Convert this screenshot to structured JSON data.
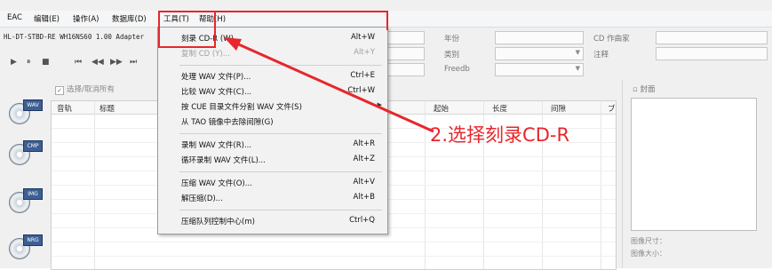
{
  "menubar": {
    "items": [
      "EAC",
      "编辑(E)",
      "操作(A)",
      "数据库(D)",
      "工具(T)",
      "帮助(H)"
    ]
  },
  "drive": {
    "label": "HL-DT-STBD-RE  WH16NS60 1.00  Adapter"
  },
  "transport": {
    "buttons": [
      "▶",
      "⏸",
      "■",
      "⏮",
      "◀◀",
      "▶▶",
      "⏭"
    ]
  },
  "fields": {
    "year_label": "年份",
    "genre_label": "类别",
    "freedb_label": "Freedb",
    "cd_artist_label": "CD 作曲家",
    "notes_label": "注释"
  },
  "select_all": {
    "label": "选择/取消所有"
  },
  "side_icons": [
    "WAV",
    "CMP",
    "IMG",
    "NRG"
  ],
  "track_columns": [
    "音轨",
    "标题",
    "起始",
    "长度",
    "间隙",
    "ブ"
  ],
  "cover": {
    "label": "封面",
    "image_size": "图像尺寸：",
    "image_bytes": "图像大小："
  },
  "tools_menu": {
    "items": [
      {
        "label": "刻录 CD-R (W)...",
        "shortcut": "Alt+W",
        "disabled": false
      },
      {
        "label": "复制 CD (Y)...",
        "shortcut": "Alt+Y",
        "disabled": true
      },
      {
        "label": "处理 WAV 文件(P)...",
        "shortcut": "Ctrl+E",
        "disabled": false
      },
      {
        "label": "比较 WAV 文件(C)...",
        "shortcut": "Ctrl+W",
        "disabled": false
      },
      {
        "label": "按 CUE 目录文件分割 WAV 文件(S)",
        "shortcut": "",
        "disabled": false
      },
      {
        "label": "从 TAO 镜像中去除间隙(G)",
        "shortcut": "",
        "disabled": false
      },
      {
        "label": "录制 WAV 文件(R)...",
        "shortcut": "Alt+R",
        "disabled": false
      },
      {
        "label": "循环录制 WAV 文件(L)...",
        "shortcut": "Alt+Z",
        "disabled": false
      },
      {
        "label": "压缩 WAV 文件(O)...",
        "shortcut": "Alt+V",
        "disabled": false
      },
      {
        "label": "解压缩(D)...",
        "shortcut": "Alt+B",
        "disabled": false
      },
      {
        "label": "压缩队列控制中心(m)",
        "shortcut": "Ctrl+Q",
        "disabled": false
      }
    ]
  },
  "annotation": {
    "text": "2.选择刻录CD-R",
    "color": "#e8262b"
  }
}
